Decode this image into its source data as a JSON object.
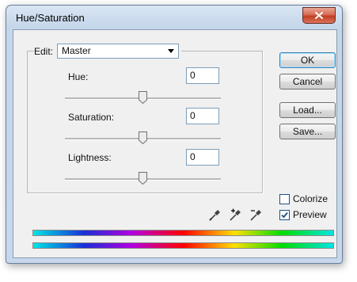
{
  "window": {
    "title": "Hue/Saturation"
  },
  "edit": {
    "label": "Edit:",
    "selected": "Master"
  },
  "adjustments": [
    {
      "label": "Hue:",
      "value": "0",
      "slider_fraction": 0.5
    },
    {
      "label": "Saturation:",
      "value": "0",
      "slider_fraction": 0.5
    },
    {
      "label": "Lightness:",
      "value": "0",
      "slider_fraction": 0.5
    }
  ],
  "buttons": {
    "ok": "OK",
    "cancel": "Cancel",
    "load": "Load...",
    "save": "Save..."
  },
  "options": {
    "colorize": {
      "label": "Colorize",
      "checked": false
    },
    "preview": {
      "label": "Preview",
      "checked": true
    }
  },
  "icons": [
    "close-icon",
    "dropdown-arrow-icon",
    "eyedropper-icon",
    "eyedropper-plus-icon",
    "eyedropper-minus-icon",
    "checkmark-icon"
  ],
  "colors": {
    "title_bar": "#c4d6ea",
    "close_button": "#c13f23",
    "dialog_background": "#f0f0f0"
  }
}
